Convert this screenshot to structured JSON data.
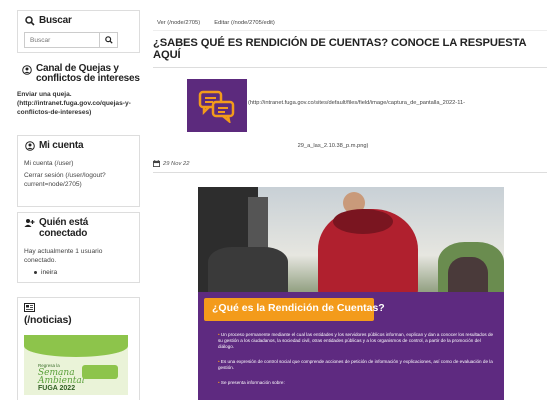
{
  "search": {
    "title": "Buscar",
    "placeholder": "Buscar"
  },
  "complaints": {
    "title": "Canal de Quejas y conflictos de intereses",
    "text_bold": "Enviar una queja.",
    "link": "(http://intranet.fuga.gov.co/quejas-y-conflictos-de-intereses)"
  },
  "account": {
    "title": "Mi cuenta",
    "my_account": "Mi cuenta (/user)",
    "logout": "Cerrar sesión (/user/logout?current=node/2705)"
  },
  "online": {
    "title": "Quién está conectado",
    "text": "Hay actualmente 1 usuario conectado.",
    "users": [
      "ineira"
    ]
  },
  "news": {
    "title": "(/noticias)",
    "thumb_line1": "Regresa la",
    "thumb_line2": "Semana",
    "thumb_line3": "Ambiental",
    "thumb_line4": "FUGA 2022"
  },
  "tabs": [
    "Ver (/node/2705)",
    "Editar (/node/2705/edit)"
  ],
  "page_title": "¿SABES QUÉ ES RENDICIÓN DE CUENTAS? CONOCE LA RESPUESTA AQUÍ",
  "image": {
    "caption_line1": "(http://intranet.fuga.gov.co/sites/default/files/field/image/captura_de_pantalla_2022-11-",
    "caption_line2": "29_a_las_2.10.38_p.m.png)"
  },
  "date": "29 Nov 22",
  "poster": {
    "heading": "¿Qué es la Rendición de Cuentas?",
    "p1": "Un proceso permanente mediante el cual las entidades y los servidores públicos informan, explican y dan a conocer los resultados de su gestión a los ciudadanos, la sociedad civil, otras entidades públicas y a los organismos de control, a partir de la promoción del diálogo.",
    "p2": "Es una expresión de control social que comprende acciones de petición de información y explicaciones, así como de evaluación de la gestión.",
    "p3": "Se presenta información sobre:"
  },
  "colors": {
    "purple": "#5e2a80",
    "orange": "#f39b1b"
  }
}
